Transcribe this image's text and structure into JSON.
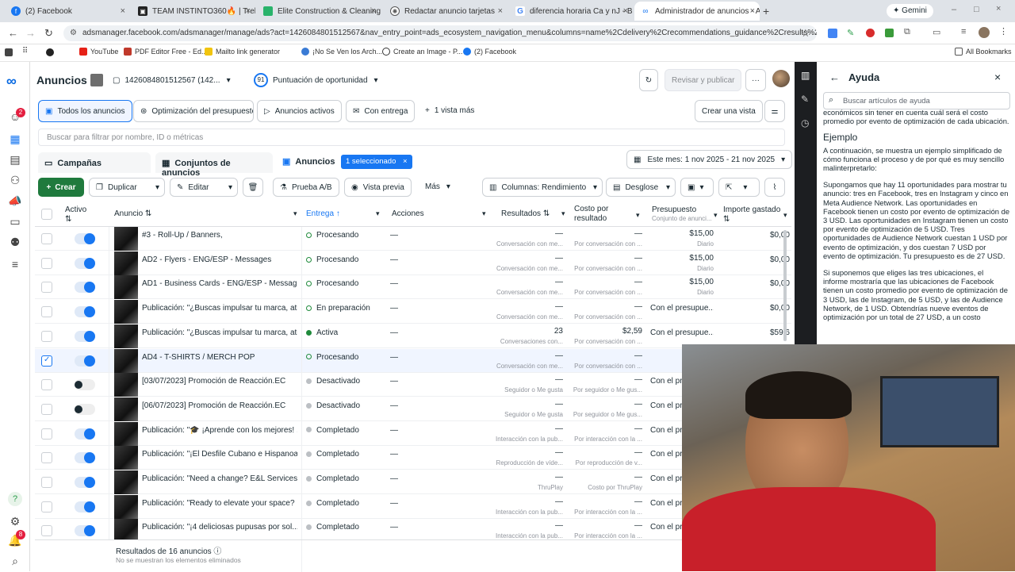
{
  "browser": {
    "tabs": [
      {
        "label": "(2) Facebook",
        "icon": "facebook-icon",
        "color": "#1877f2"
      },
      {
        "label": "TEAM INSTINTO360🔥 | Trello",
        "icon": "trello-icon",
        "color": "#222"
      },
      {
        "label": "Elite Construction & Cleaning |",
        "icon": "green-app-icon",
        "color": "#29b36b"
      },
      {
        "label": "Redactar anuncio tarjetas",
        "icon": "chatgpt-icon",
        "color": "#555"
      },
      {
        "label": "diferencia horaria Ca y nJ - Bus",
        "icon": "google-icon",
        "color": "#4285f4"
      },
      {
        "label": "Administrador de anuncios - Ac",
        "icon": "meta-icon",
        "color": "#1877f2"
      }
    ],
    "gemini_label": "Gemini",
    "url": "adsmanager.facebook.com/adsmanager/manage/ads?act=1426084801512567&nav_entry_point=ads_ecosystem_navigation_menu&columns=name%2Cdelivery%2Crecommendations_guidance%2Cresults%2Ccost_pe...",
    "bookmarks": [
      "YouTube",
      "PDF Editor Free - Ed...",
      "Mailto link generator",
      "¡No Se Ven los Arch...",
      "Create an Image - P...",
      "(2) Facebook"
    ],
    "all_bookmarks": "All Bookmarks"
  },
  "rail": {
    "notif_badge": "2",
    "bell_badge": "8"
  },
  "header": {
    "title": "Anuncios",
    "account": "1426084801512567 (142...",
    "score": "91",
    "score_label": "Puntuación de oportunidad",
    "review_button": "Revisar y publicar",
    "more": "···"
  },
  "views": {
    "tabs": [
      "Todos los anuncios",
      "Optimización del presupuesto",
      "Anuncios activos",
      "Con entrega"
    ],
    "more_views": "1 vista más",
    "create_view": "Crear una vista"
  },
  "search": {
    "placeholder": "Buscar para filtrar por nombre, ID o métricas"
  },
  "levels": {
    "campaigns": "Campañas",
    "adsets": "Conjuntos de anuncios",
    "ads": "Anuncios",
    "selected": "1 seleccionado",
    "date_range": "Este mes: 1 nov 2025 - 21 nov 2025"
  },
  "toolbar": {
    "create": "Crear",
    "duplicate": "Duplicar",
    "edit": "Editar",
    "ab_test": "Prueba A/B",
    "preview": "Vista previa",
    "more": "Más",
    "columns": "Columnas: Rendimiento",
    "breakdown": "Desglose"
  },
  "table": {
    "headers": {
      "active": "Activo",
      "ad": "Anuncio",
      "delivery": "Entrega",
      "actions": "Acciones",
      "results": "Resultados",
      "cost": "Costo por resultado",
      "budget": "Presupuesto",
      "budget_sub": "Conjunto de anunci...",
      "spent": "Importe gastado"
    },
    "rows": [
      {
        "on": true,
        "name": "#3 - Roll-Up / Banners,",
        "status": "Procesando",
        "dot": "ring",
        "action": "—",
        "results": "—",
        "results_sub": "Conversación con me...",
        "cost": "—",
        "cost_sub": "Por conversación con ...",
        "budget": "$15,00",
        "budget_sub": "Diario",
        "spent": "$0,00",
        "checked": false
      },
      {
        "on": true,
        "name": "AD2 - Flyers - ENG/ESP - Messages",
        "status": "Procesando",
        "dot": "ring",
        "action": "—",
        "results": "—",
        "results_sub": "Conversación con me...",
        "cost": "—",
        "cost_sub": "Por conversación con ...",
        "budget": "$15,00",
        "budget_sub": "Diario",
        "spent": "$0,00",
        "checked": false
      },
      {
        "on": true,
        "name": "AD1 - Business Cards - ENG/ESP - Messag...",
        "status": "Procesando",
        "dot": "ring",
        "action": "—",
        "results": "—",
        "results_sub": "Conversación con me...",
        "cost": "—",
        "cost_sub": "Por conversación con ...",
        "budget": "$15,00",
        "budget_sub": "Diario",
        "spent": "$0,00",
        "checked": false
      },
      {
        "on": true,
        "name": "Publicación: \"¿Buscas impulsar tu marca, atr...",
        "status": "En preparación",
        "dot": "ring",
        "action": "—",
        "results": "—",
        "results_sub": "Conversación con me...",
        "cost": "—",
        "cost_sub": "Por conversación con ...",
        "budget": "Con el presupue...",
        "budget_sub": "",
        "spent": "$0,00",
        "checked": false
      },
      {
        "on": true,
        "name": "Publicación: \"¿Buscas impulsar tu marca, atr...",
        "status": "Activa",
        "dot": "green",
        "action": "—",
        "results": "23",
        "results_sub": "Conversaciones con...",
        "cost": "$2,59",
        "cost_sub": "Por conversación con ...",
        "budget": "Con el presupue...",
        "budget_sub": "",
        "spent": "$59,6",
        "checked": false
      },
      {
        "on": true,
        "name": "AD4 - T-SHIRTS / MERCH POP",
        "status": "Procesando",
        "dot": "ring",
        "action": "—",
        "results": "—",
        "results_sub": "Conversación con me...",
        "cost": "—",
        "cost_sub": "Por conversación con ...",
        "budget": "",
        "budget_sub": "",
        "spent": "",
        "checked": true
      },
      {
        "on": false,
        "name": "[03/07/2023] Promoción de Reacción.EC",
        "status": "Desactivado",
        "dot": "gray",
        "action": "—",
        "results": "—",
        "results_sub": "Seguidor o Me gusta",
        "cost": "—",
        "cost_sub": "Por seguidor o Me gus...",
        "budget": "Con el pr",
        "budget_sub": "",
        "spent": "",
        "checked": false
      },
      {
        "on": false,
        "name": "[06/07/2023] Promoción de Reacción.EC",
        "status": "Desactivado",
        "dot": "gray",
        "action": "—",
        "results": "—",
        "results_sub": "Seguidor o Me gusta",
        "cost": "—",
        "cost_sub": "Por seguidor o Me gus...",
        "budget": "Con el pr",
        "budget_sub": "",
        "spent": "",
        "checked": false
      },
      {
        "on": true,
        "name": "Publicación: \"🎓 ¡Aprende con los mejores! ...",
        "status": "Completado",
        "dot": "gray",
        "action": "—",
        "results": "—",
        "results_sub": "Interacción con la pub...",
        "cost": "—",
        "cost_sub": "Por interacción con la ...",
        "budget": "Con el pr",
        "budget_sub": "",
        "spent": "",
        "checked": false
      },
      {
        "on": true,
        "name": "Publicación: \"¡El Desfile Cubano e Hispanoa...",
        "status": "Completado",
        "dot": "gray",
        "action": "—",
        "results": "—",
        "results_sub": "Reproducción de víde...",
        "cost": "—",
        "cost_sub": "Por reproducción de v...",
        "budget": "Con el pr",
        "budget_sub": "",
        "spent": "",
        "checked": false
      },
      {
        "on": true,
        "name": "Publicación: \"Need a change? E&L Services ...",
        "status": "Completado",
        "dot": "gray",
        "action": "—",
        "results": "—",
        "results_sub": "ThruPlay",
        "cost": "—",
        "cost_sub": "Costo por ThruPlay",
        "budget": "Con el pr",
        "budget_sub": "",
        "spent": "",
        "checked": false
      },
      {
        "on": true,
        "name": "Publicación: \"Ready to elevate your space? ...",
        "status": "Completado",
        "dot": "gray",
        "action": "—",
        "results": "—",
        "results_sub": "Interacción con la pub...",
        "cost": "—",
        "cost_sub": "Por interacción con la ...",
        "budget": "Con el pr",
        "budget_sub": "",
        "spent": "",
        "checked": false
      },
      {
        "on": true,
        "name": "Publicación: \"¡4 deliciosas pupusas por sol...",
        "status": "Completado",
        "dot": "gray",
        "action": "—",
        "results": "—",
        "results_sub": "Interacción con la pub...",
        "cost": "—",
        "cost_sub": "Por interacción con la ...",
        "budget": "Con el pr",
        "budget_sub": "",
        "spent": "",
        "checked": false
      }
    ],
    "footer_title": "Resultados de 16 anuncios",
    "footer_sub": "No se muestran los elementos eliminados"
  },
  "help": {
    "title": "Ayuda",
    "search_placeholder": "Buscar artículos de ayuda",
    "top_text": "económicos sin tener en cuenta cuál será el costo promedio por evento de optimización de cada ubicación.",
    "heading": "Ejemplo",
    "p1": "A continuación, se muestra un ejemplo simplificado de cómo funciona el proceso y de por qué es muy sencillo malinterpretarlo:",
    "p2": "Supongamos que hay 11 oportunidades para mostrar tu anuncio: tres en Facebook, tres en Instagram y cinco en Meta Audience Network. Las oportunidades en Facebook tienen un costo por evento de optimización de 3 USD. Las oportunidades en Instagram tienen un costo por evento de optimización de 5 USD. Tres oportunidades de Audience Network cuestan 1 USD por evento de optimización, y dos cuestan 7 USD por evento de optimización. Tu presupuesto es de 27 USD.",
    "p3": "Si suponemos que eliges las tres ubicaciones, el informe mostraría que las ubicaciones de Facebook tienen un costo promedio por evento de optimización de 3 USD, las de Instagram, de 5 USD, y las de Audience Network, de 1 USD. Obtendrías nueve eventos de optimización por un total de 27 USD, a un costo"
  },
  "colors": {
    "accent": "#1877f2",
    "create": "#1f7a3d",
    "active_dot": "#1f8a3b"
  }
}
